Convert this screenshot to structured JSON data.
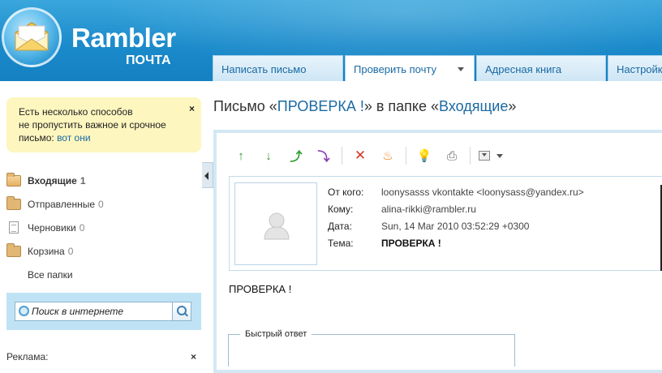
{
  "app": {
    "brand": "Rambler",
    "brand_sub": "ПОЧТА",
    "colors": {
      "header": "#1b8bcb",
      "link": "#1a6aa3",
      "notice_bg": "#fdf6bf",
      "search_panel": "#bfe3f5"
    }
  },
  "tabs": [
    {
      "label": "Написать письмо",
      "icon": ""
    },
    {
      "label": "Проверить почту",
      "icon": "chevron-down-icon"
    },
    {
      "label": "Адресная книга",
      "icon": ""
    },
    {
      "label": "Настройки",
      "icon": ""
    }
  ],
  "notice": {
    "line1": "Есть несколько способов",
    "line2": "не пропустить важное и срочное",
    "line3": "письмо:",
    "link": "вот они",
    "close": "×"
  },
  "folders": [
    {
      "name": "Входящие",
      "count": "1",
      "icon": "folder-open-icon"
    },
    {
      "name": "Отправленные",
      "count": "0",
      "icon": "folder-icon"
    },
    {
      "name": "Черновики",
      "count": "0",
      "icon": "document-icon"
    },
    {
      "name": "Корзина",
      "count": "0",
      "icon": "folder-icon"
    }
  ],
  "all_folders": "Все папки",
  "search": {
    "placeholder": "Поиск в интернете"
  },
  "ads": {
    "label": "Реклама:",
    "close": "×"
  },
  "title": {
    "prefix": "Письмо «",
    "subject": "ПРОВЕРКА !",
    "middle": "» в папке «",
    "folder": "Входящие",
    "suffix": "»"
  },
  "toolbar": {
    "icons": [
      "arrow-up-icon",
      "arrow-down-icon",
      "reply-icon",
      "forward-icon",
      "delete-icon",
      "spam-fire-icon",
      "lightbulb-icon",
      "print-icon",
      "download-icon"
    ]
  },
  "message": {
    "from_label": "От кого:",
    "from": "loonysasss vkontakte <loonysass@yandex.ru>",
    "to_label": "Кому:",
    "to": "alina-rikki@rambler.ru",
    "date_label": "Дата:",
    "date": "Sun, 14 Mar 2010 03:52:29 +0300",
    "subject_label": "Тема:",
    "subject": "ПРОВЕРКА !",
    "body": "ПРОВЕРКА !"
  },
  "quick_reply": {
    "label": "Быстрый ответ"
  }
}
